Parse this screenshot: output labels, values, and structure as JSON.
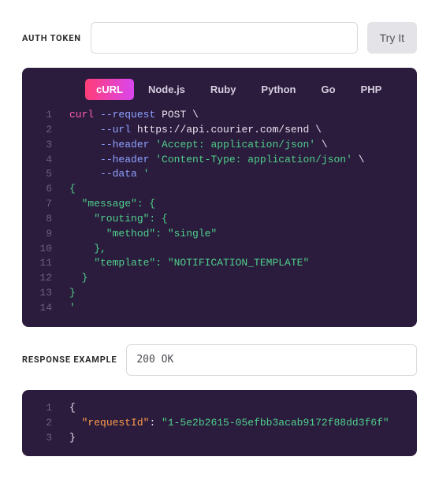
{
  "auth": {
    "label": "AUTH TOKEN",
    "value": "",
    "try_label": "Try It"
  },
  "tabs": [
    {
      "label": "cURL",
      "active": true
    },
    {
      "label": "Node.js",
      "active": false
    },
    {
      "label": "Ruby",
      "active": false
    },
    {
      "label": "Python",
      "active": false
    },
    {
      "label": "Go",
      "active": false
    },
    {
      "label": "PHP",
      "active": false
    }
  ],
  "request_code": {
    "line_count": 14,
    "tokens": [
      [
        {
          "t": "curl",
          "c": "cmd"
        },
        {
          "t": " ",
          "c": "arg"
        },
        {
          "t": "--request",
          "c": "flag"
        },
        {
          "t": " ",
          "c": "arg"
        },
        {
          "t": "POST",
          "c": "arg"
        },
        {
          "t": " \\",
          "c": "arg"
        }
      ],
      [
        {
          "t": "     ",
          "c": "arg"
        },
        {
          "t": "--url",
          "c": "flag"
        },
        {
          "t": " ",
          "c": "arg"
        },
        {
          "t": "https://api.courier.com/send",
          "c": "arg"
        },
        {
          "t": " \\",
          "c": "arg"
        }
      ],
      [
        {
          "t": "     ",
          "c": "arg"
        },
        {
          "t": "--header",
          "c": "flag"
        },
        {
          "t": " ",
          "c": "arg"
        },
        {
          "t": "'Accept: application/json'",
          "c": "str"
        },
        {
          "t": " \\",
          "c": "arg"
        }
      ],
      [
        {
          "t": "     ",
          "c": "arg"
        },
        {
          "t": "--header",
          "c": "flag"
        },
        {
          "t": " ",
          "c": "arg"
        },
        {
          "t": "'Content-Type: application/json'",
          "c": "str"
        },
        {
          "t": " \\",
          "c": "arg"
        }
      ],
      [
        {
          "t": "     ",
          "c": "arg"
        },
        {
          "t": "--data",
          "c": "flag"
        },
        {
          "t": " ",
          "c": "arg"
        },
        {
          "t": "'",
          "c": "str"
        }
      ],
      [
        {
          "t": "{",
          "c": "str"
        }
      ],
      [
        {
          "t": "  \"message\": {",
          "c": "str"
        }
      ],
      [
        {
          "t": "    \"routing\": {",
          "c": "str"
        }
      ],
      [
        {
          "t": "      \"method\": \"single\"",
          "c": "str"
        }
      ],
      [
        {
          "t": "    },",
          "c": "str"
        }
      ],
      [
        {
          "t": "    \"template\": \"NOTIFICATION_TEMPLATE\"",
          "c": "str"
        }
      ],
      [
        {
          "t": "  }",
          "c": "str"
        }
      ],
      [
        {
          "t": "}",
          "c": "str"
        }
      ],
      [
        {
          "t": "'",
          "c": "str"
        }
      ]
    ]
  },
  "response": {
    "label": "RESPONSE EXAMPLE",
    "status": "200 OK"
  },
  "response_code": {
    "line_count": 3,
    "tokens": [
      [
        {
          "t": "{",
          "c": "punc"
        }
      ],
      [
        {
          "t": "  ",
          "c": "punc"
        },
        {
          "t": "\"requestId\"",
          "c": "key"
        },
        {
          "t": ": ",
          "c": "punc"
        },
        {
          "t": "\"1-5e2b2615-05efbb3acab9172f88dd3f6f\"",
          "c": "str"
        }
      ],
      [
        {
          "t": "}",
          "c": "punc"
        }
      ]
    ]
  }
}
